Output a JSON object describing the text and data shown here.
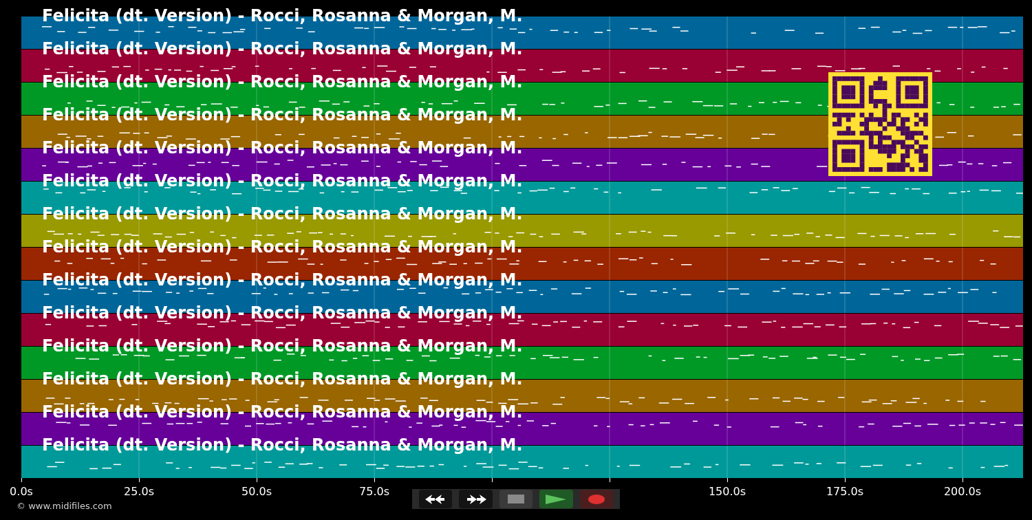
{
  "tracks": [
    {
      "title": "Felicita (dt. Version) - Rocci, Rosanna & Morgan, M.",
      "color": "#006699"
    },
    {
      "title": "Felicita (dt. Version) - Rocci, Rosanna & Morgan, M.",
      "color": "#990033"
    },
    {
      "title": "Felicita (dt. Version) - Rocci, Rosanna & Morgan, M.",
      "color": "#009926"
    },
    {
      "title": "Felicita (dt. Version) - Rocci, Rosanna & Morgan, M.",
      "color": "#996600"
    },
    {
      "title": "Felicita (dt. Version) - Rocci, Rosanna & Morgan, M.",
      "color": "#660099"
    },
    {
      "title": "Felicita (dt. Version) - Rocci, Rosanna & Morgan, M.",
      "color": "#009999"
    },
    {
      "title": "Felicita (dt. Version) - Rocci, Rosanna & Morgan, M.",
      "color": "#999900"
    },
    {
      "title": "Felicita (dt. Version) - Rocci, Rosanna & Morgan, M.",
      "color": "#992600"
    },
    {
      "title": "Felicita (dt. Version) - Rocci, Rosanna & Morgan, M.",
      "color": "#006699"
    },
    {
      "title": "Felicita (dt. Version) - Rocci, Rosanna & Morgan, M.",
      "color": "#990033"
    },
    {
      "title": "Felicita (dt. Version) - Rocci, Rosanna & Morgan, M.",
      "color": "#009926"
    },
    {
      "title": "Felicita (dt. Version) - Rocci, Rosanna & Morgan, M.",
      "color": "#996600"
    },
    {
      "title": "Felicita (dt. Version) - Rocci, Rosanna & Morgan, M.",
      "color": "#660099"
    },
    {
      "title": "Felicita (dt. Version) - Rocci, Rosanna & Morgan, M.",
      "color": "#009999"
    }
  ],
  "time_axis": {
    "left_labels": [
      "0.0s",
      "25.0s",
      "50.0s",
      "75.0s"
    ],
    "right_labels": [
      "150.0s",
      "175.0s",
      "200.0s"
    ]
  },
  "transport": [
    {
      "kind": "rewind"
    },
    {
      "kind": "forward"
    },
    {
      "kind": "stop"
    },
    {
      "kind": "play"
    },
    {
      "kind": "record"
    }
  ],
  "copyright": "© www.midifiles.com"
}
